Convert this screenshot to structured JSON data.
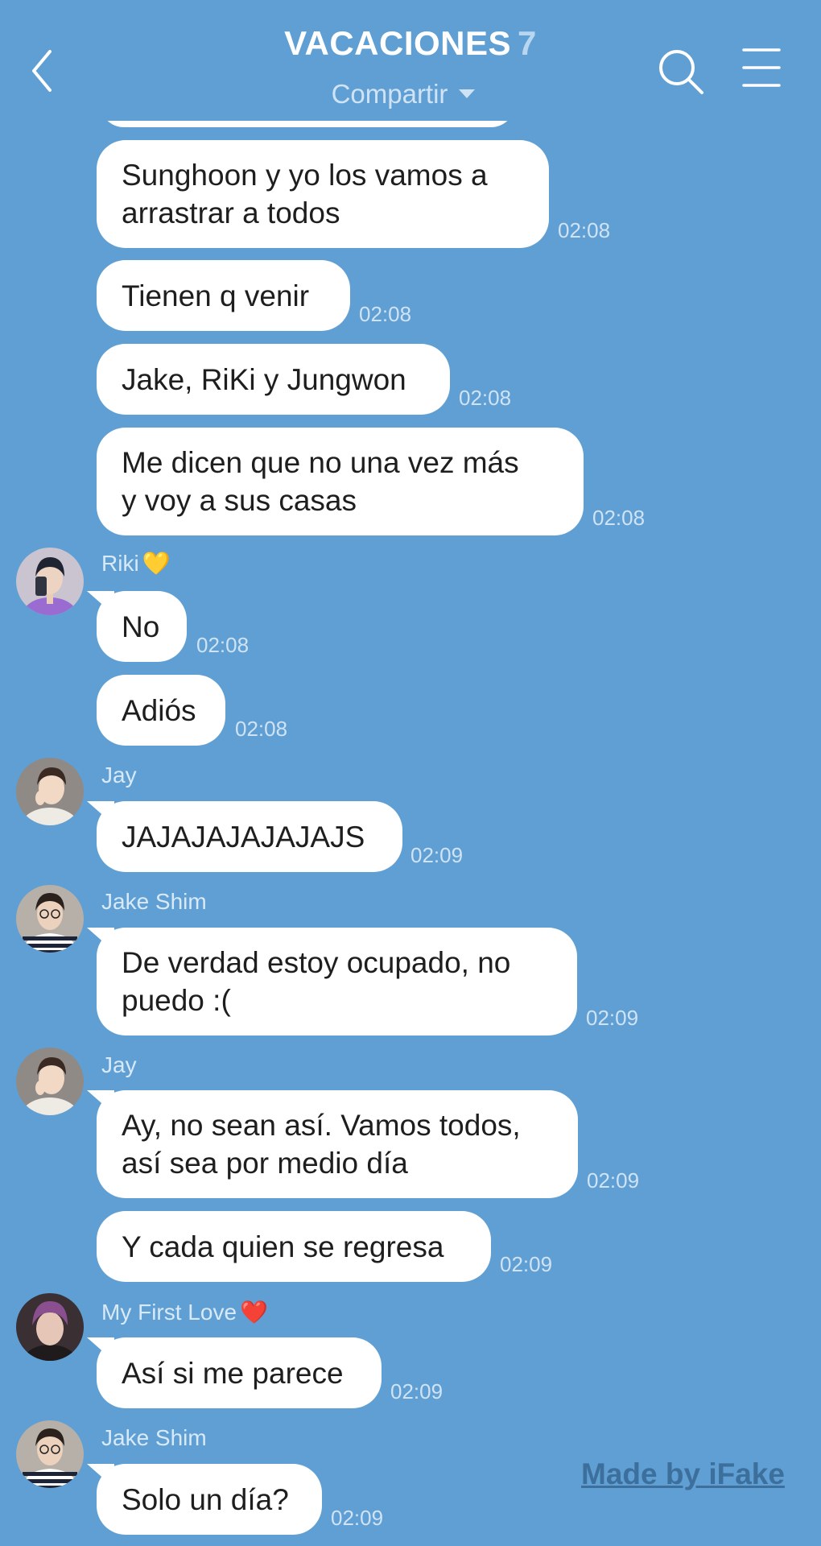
{
  "header": {
    "title": "VACACIONES",
    "member_count": "7",
    "share_label": "Compartir"
  },
  "icons": {
    "back": "chevron-left-icon",
    "search": "search-icon",
    "menu": "hamburger-menu-icon"
  },
  "colors": {
    "background": "#5f9fd3",
    "bubble": "#ffffff",
    "timestamp": "#cfe3f5",
    "sender_name": "#d8e9f7"
  },
  "messages": [
    {
      "text": "Sunghoon y yo los vamos a\narrastrar a todos",
      "time": "02:08"
    },
    {
      "text": "Tienen q venir",
      "time": "02:08"
    },
    {
      "text": "Jake, RiKi y Jungwon",
      "time": "02:08"
    },
    {
      "text": "Me dicen que no una vez más\ny voy a sus casas",
      "time": "02:08"
    },
    {
      "sender": "Riki",
      "sender_emoji": "💛",
      "text": "No",
      "time": "02:08"
    },
    {
      "text": "Adiós",
      "time": "02:08"
    },
    {
      "sender": "Jay",
      "text": "JAJAJAJAJAJAJS",
      "time": "02:09"
    },
    {
      "sender": "Jake Shim",
      "text": "De verdad estoy ocupado, no\npuedo :(",
      "time": "02:09"
    },
    {
      "sender": "Jay",
      "text": "Ay, no sean así. Vamos todos,\nasí sea por medio día",
      "time": "02:09"
    },
    {
      "text": "Y cada quien se regresa",
      "time": "02:09"
    },
    {
      "sender": "My First Love",
      "sender_emoji": "❤️",
      "text": "Así si me parece",
      "time": "02:09"
    },
    {
      "sender": "Jake Shim",
      "text": "Solo un día?",
      "time": "02:09"
    }
  ],
  "watermark": "Made by iFake"
}
